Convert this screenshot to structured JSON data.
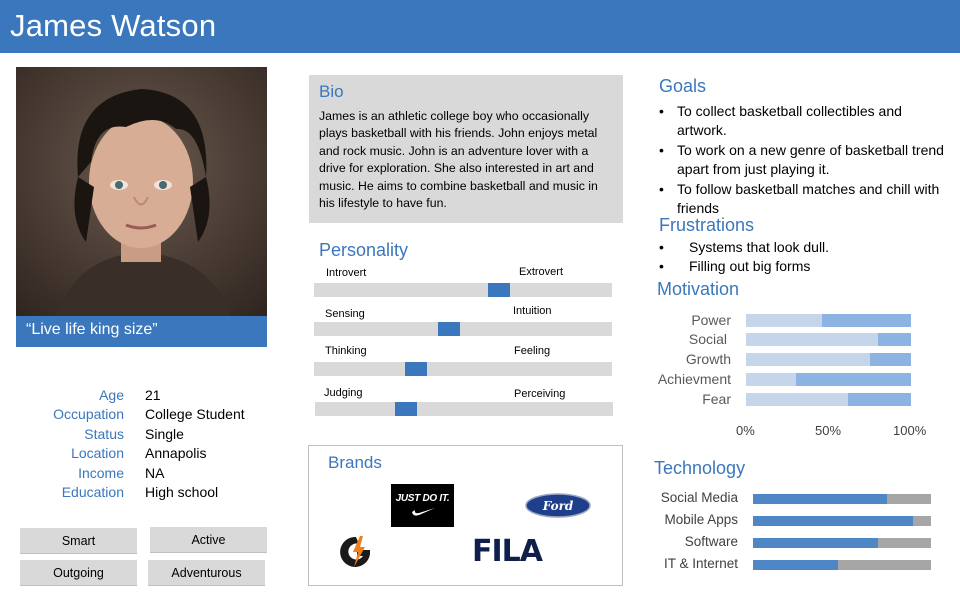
{
  "persona": {
    "name": "James Watson",
    "quote": "“Live life king size”"
  },
  "info": [
    {
      "label": "Age",
      "value": "21"
    },
    {
      "label": "Occupation",
      "value": "College Student"
    },
    {
      "label": "Status",
      "value": "Single"
    },
    {
      "label": "Location",
      "value": "Annapolis"
    },
    {
      "label": "Income",
      "value": "NA"
    },
    {
      "label": "Education",
      "value": "High school"
    }
  ],
  "traits": [
    "Smart",
    "Active",
    "Outgoing",
    "Adventurous"
  ],
  "bio": {
    "title": "Bio",
    "text": "James is an athletic college boy who occasionally plays basketball with his friends. John enjoys metal and rock music. John is an adventure lover with a drive for exploration. She also interested in art and music. He aims to combine basketball and music  in his lifestyle to have fun."
  },
  "personality": {
    "title": "Personality",
    "scales": [
      {
        "left": "Introvert",
        "right": "Extrovert",
        "position": 0.63
      },
      {
        "left": "Sensing",
        "right": "Intuition",
        "position": 0.45
      },
      {
        "left": "Thinking",
        "right": "Feeling",
        "position": 0.33
      },
      {
        "left": "Judging",
        "right": "Perceiving",
        "position": 0.29
      }
    ]
  },
  "brands": {
    "title": "Brands",
    "items": [
      "JUST DO IT.",
      "Ford",
      "G",
      "FILA"
    ]
  },
  "goals": {
    "title": "Goals",
    "items": [
      "To collect basketball collectibles and artwork.",
      "To work on a new genre of basketball trend apart from just playing it.",
      "To follow basketball matches and chill with friends"
    ]
  },
  "frustrations": {
    "title": "Frustrations",
    "items": [
      "Systems that look dull.",
      "Filling out big forms"
    ]
  },
  "motivation": {
    "title": "Motivation",
    "categories": [
      "Power",
      "Social",
      "Growth",
      "Achievment",
      "Fear"
    ],
    "values": [
      0.46,
      0.8,
      0.75,
      0.3,
      0.62
    ],
    "axis": [
      "0%",
      "50%",
      "100%"
    ]
  },
  "technology": {
    "title": "Technology",
    "categories": [
      "Social Media",
      "Mobile Apps",
      "Software",
      "IT & Internet"
    ],
    "values": [
      0.75,
      0.9,
      0.7,
      0.48
    ]
  },
  "colors": {
    "accent": "#3a77bc",
    "panel": "#d9d9d9"
  }
}
